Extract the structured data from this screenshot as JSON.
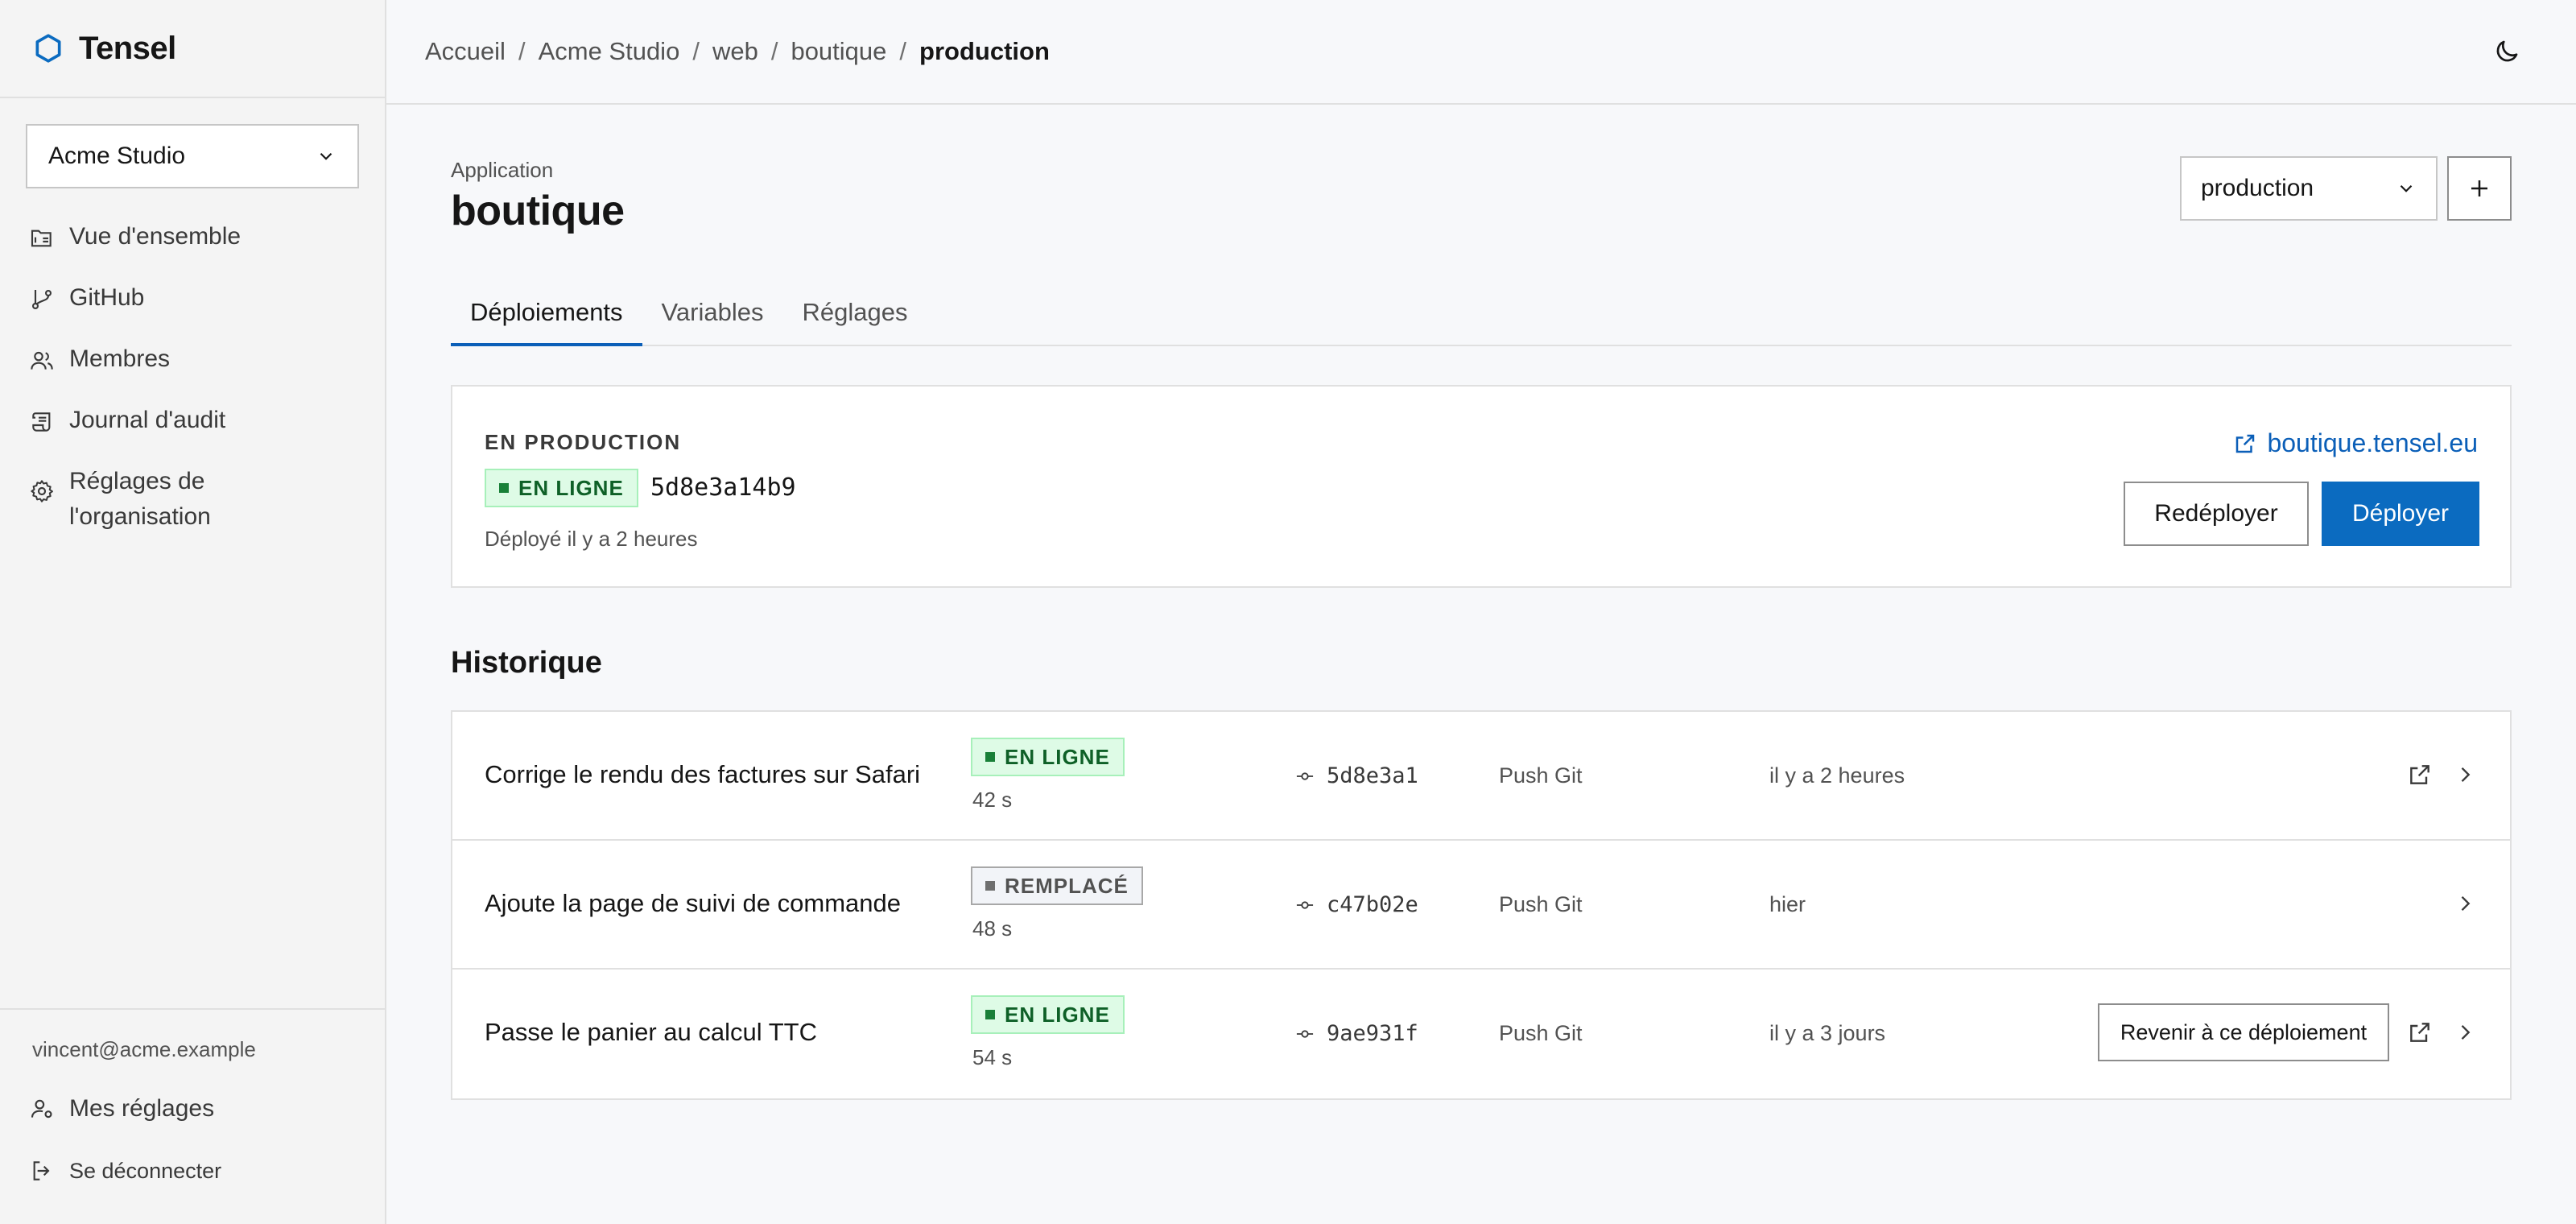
{
  "brand": {
    "name": "Tensel",
    "icon": "hexagon-icon",
    "accent": "#0b6bc0"
  },
  "sidebar": {
    "org_select": "Acme Studio",
    "items": [
      {
        "label": "Vue d'ensemble",
        "icon": "folder-overview-icon"
      },
      {
        "label": "GitHub",
        "icon": "git-branch-icon"
      },
      {
        "label": "Membres",
        "icon": "users-icon"
      },
      {
        "label": "Journal d'audit",
        "icon": "scroll-icon"
      },
      {
        "label": "Réglages de l'organisation",
        "icon": "gear-icon"
      }
    ],
    "user_email": "vincent@acme.example",
    "my_settings": "Mes réglages",
    "logout": "Se déconnecter"
  },
  "breadcrumb": [
    "Accueil",
    "Acme Studio",
    "web",
    "boutique",
    "production"
  ],
  "page": {
    "kicker": "Application",
    "title": "boutique",
    "environment": "production"
  },
  "tabs": [
    "Déploiements",
    "Variables",
    "Réglages"
  ],
  "production": {
    "label": "EN PRODUCTION",
    "status": "EN LIGNE",
    "commit": "5d8e3a14b9",
    "deployed": "Déployé il y a 2 heures",
    "url": "boutique.tensel.eu",
    "redeploy": "Redéployer",
    "deploy": "Déployer"
  },
  "history": {
    "title": "Historique",
    "rows": [
      {
        "message": "Corrige le rendu des factures sur Safari",
        "status": "EN LIGNE",
        "status_kind": "ok",
        "duration": "42 s",
        "commit": "5d8e3a1",
        "trigger": "Push Git",
        "when": "il y a 2 heures",
        "revert": ""
      },
      {
        "message": "Ajoute la page de suivi de commande",
        "status": "REMPLACÉ",
        "status_kind": "replaced",
        "duration": "48 s",
        "commit": "c47b02e",
        "trigger": "Push Git",
        "when": "hier",
        "revert": ""
      },
      {
        "message": "Passe le panier au calcul TTC",
        "status": "EN LIGNE",
        "status_kind": "ok",
        "duration": "54 s",
        "commit": "9ae931f",
        "trigger": "Push Git",
        "when": "il y a 3 jours",
        "revert": "Revenir à ce déploiement"
      }
    ]
  }
}
